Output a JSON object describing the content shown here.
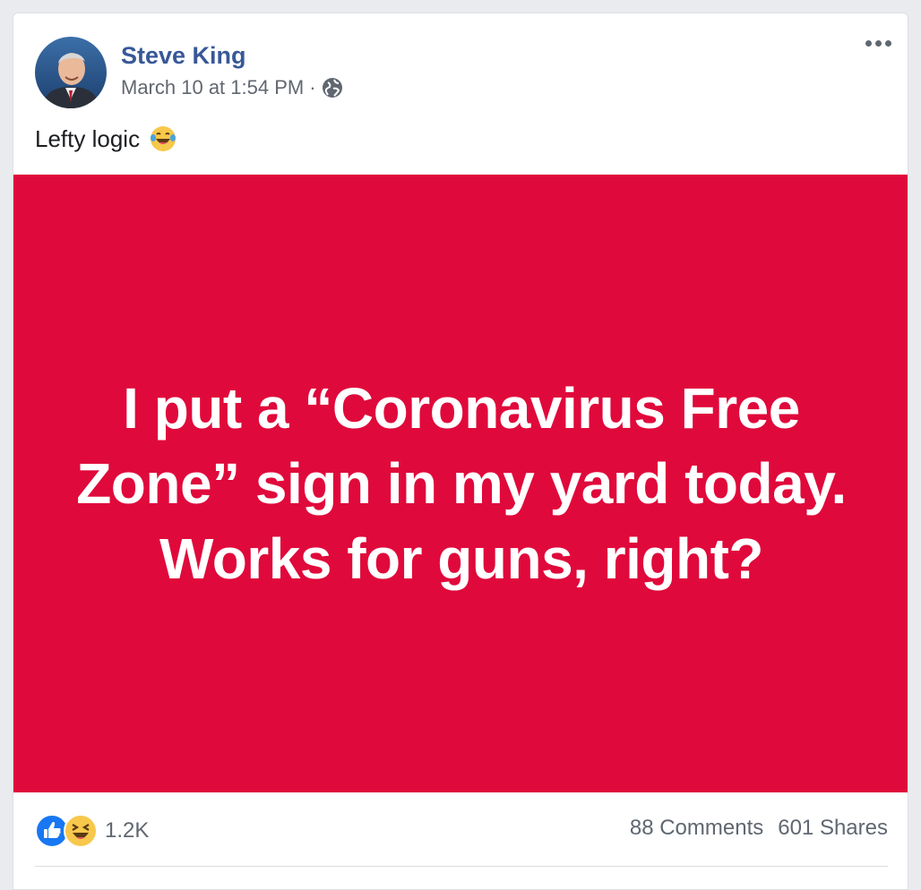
{
  "post": {
    "author": "Steve King",
    "timestamp": "March 10 at 1:54 PM",
    "separator": "·",
    "privacy_icon": "globe-icon",
    "caption": "Lefty logic",
    "caption_emoji": "laughing-tears-emoji",
    "image": {
      "text": "I put a “Coronavirus Free Zone” sign in my yard today. Works for guns, right?",
      "background": "#e0093b",
      "text_color": "#ffffff"
    },
    "reactions": {
      "icons": [
        "like-icon",
        "haha-icon"
      ],
      "count": "1.2K"
    },
    "comments": "88 Comments",
    "shares": "601 Shares"
  },
  "colors": {
    "author_link": "#385898",
    "meta_text": "#616770",
    "like_blue": "#1877f2",
    "haha_yellow": "#f7c84b"
  }
}
